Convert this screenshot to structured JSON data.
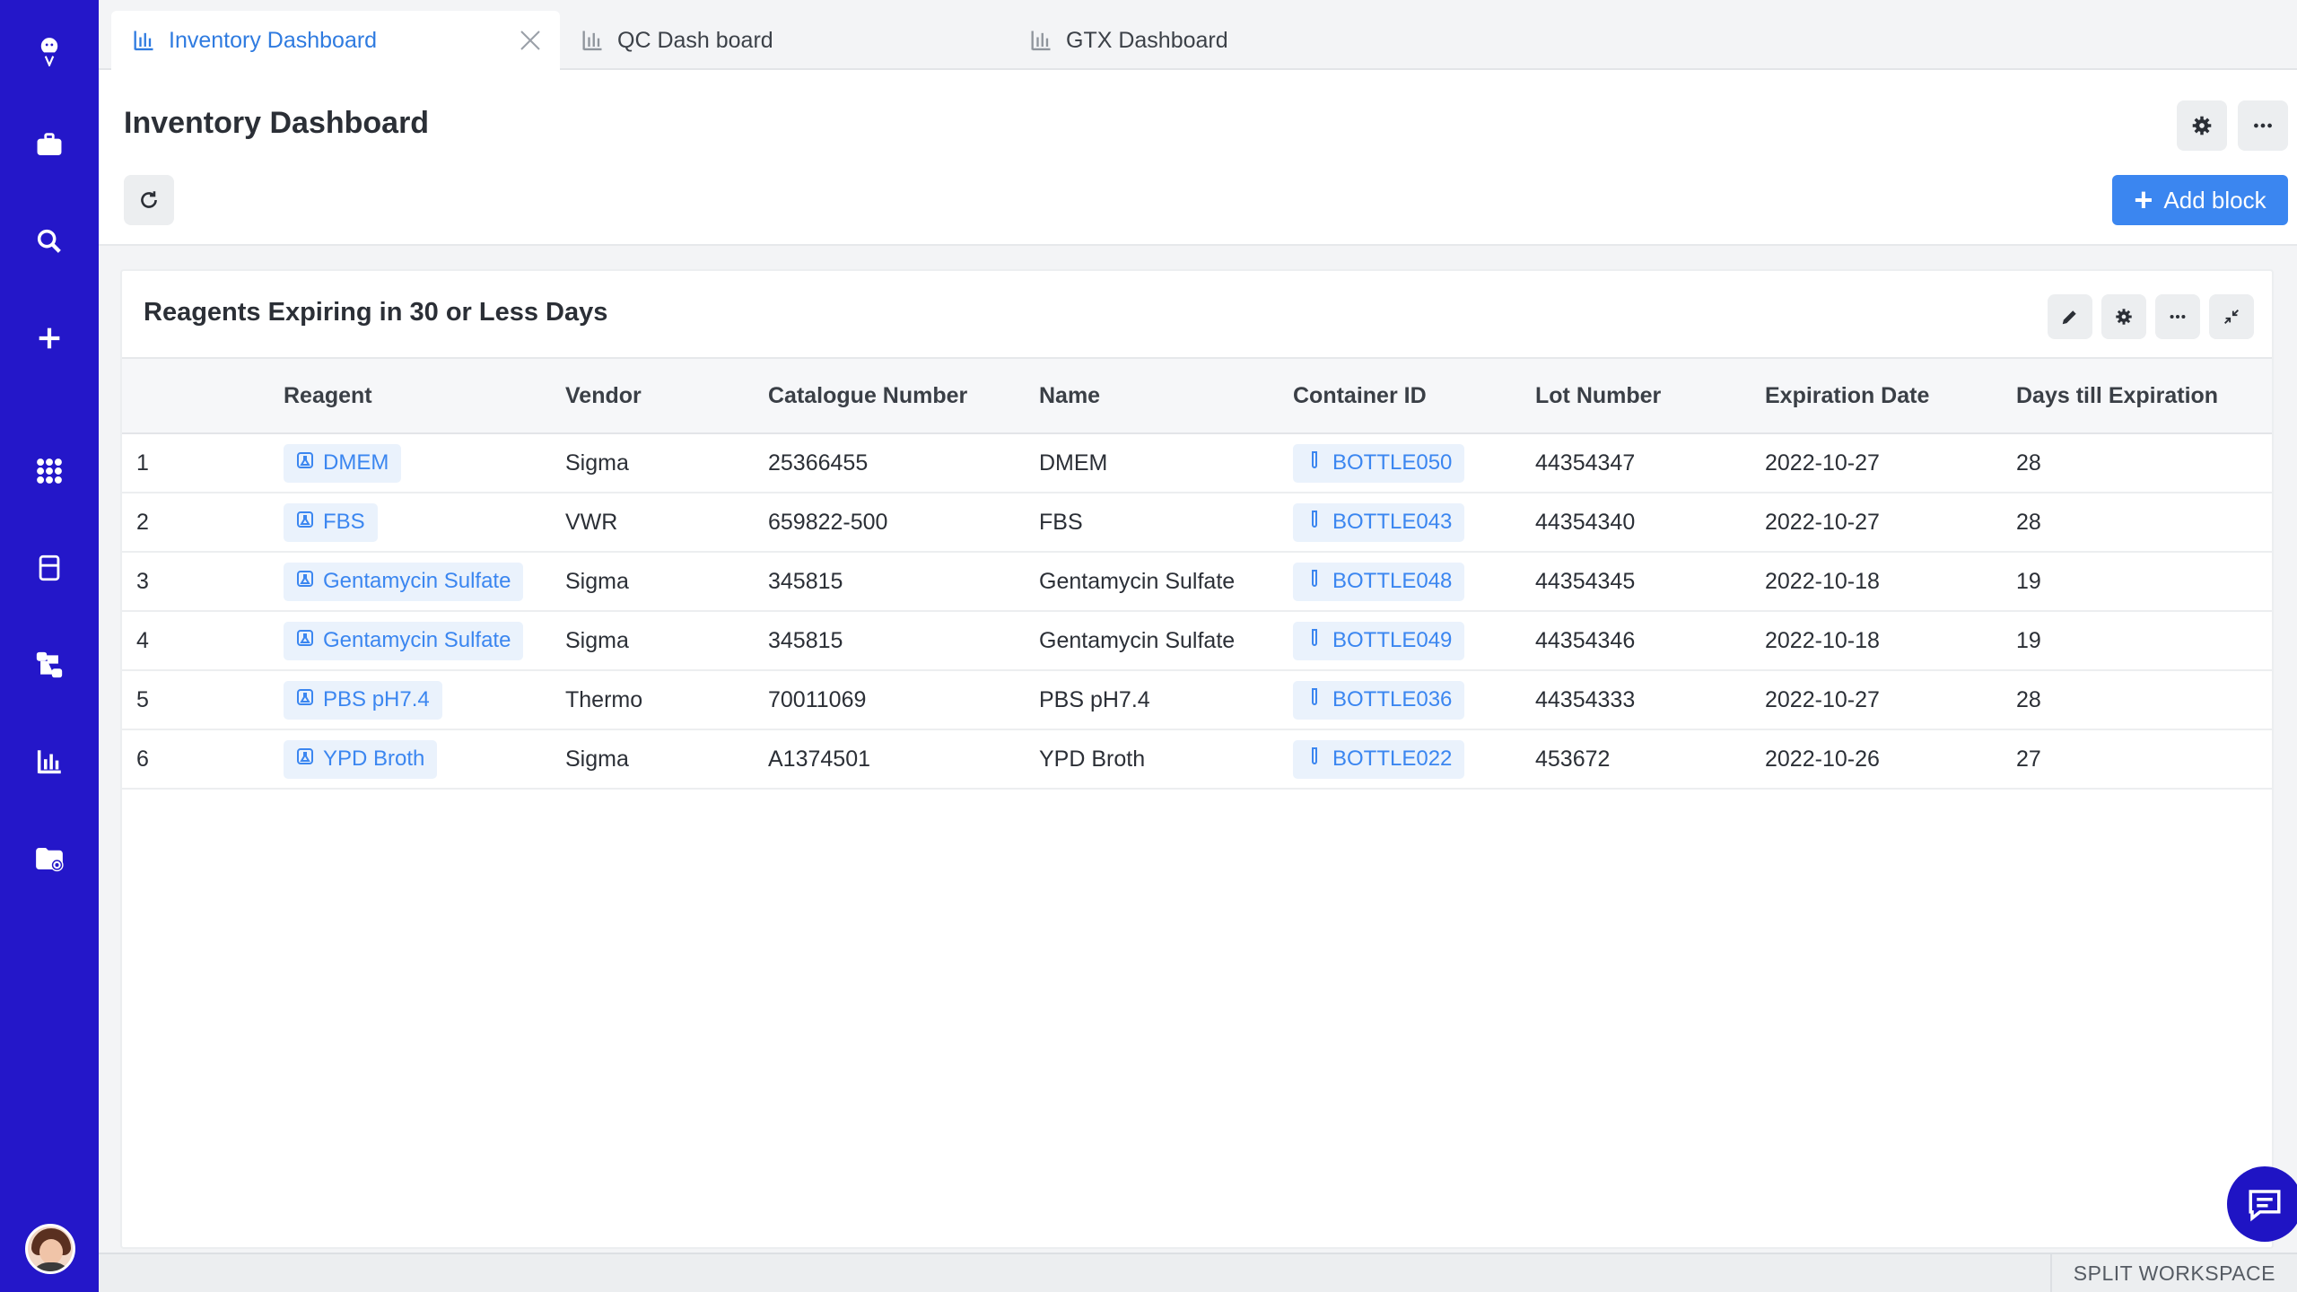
{
  "tabs": [
    {
      "label": "Inventory Dashboard",
      "active": true
    },
    {
      "label": "QC Dash board",
      "active": false
    },
    {
      "label": "GTX Dashboard",
      "active": false
    }
  ],
  "header": {
    "title": "Inventory Dashboard",
    "add_block_label": "Add block"
  },
  "card": {
    "title": "Reagents Expiring in 30 or Less Days",
    "columns": [
      "",
      "Reagent",
      "Vendor",
      "Catalogue Number",
      "Name",
      "Container ID",
      "Lot Number",
      "Expiration Date",
      "Days till Expiration"
    ],
    "rows": [
      {
        "index": "1",
        "reagent": "DMEM",
        "vendor": "Sigma",
        "catalogue": "25366455",
        "name": "DMEM",
        "container": "BOTTLE050",
        "lot": "44354347",
        "expiration": "2022-10-27",
        "days": "28"
      },
      {
        "index": "2",
        "reagent": "FBS",
        "vendor": "VWR",
        "catalogue": "659822-500",
        "name": "FBS",
        "container": "BOTTLE043",
        "lot": "44354340",
        "expiration": "2022-10-27",
        "days": "28"
      },
      {
        "index": "3",
        "reagent": "Gentamycin Sulfate",
        "vendor": "Sigma",
        "catalogue": "345815",
        "name": "Gentamycin Sulfate",
        "container": "BOTTLE048",
        "lot": "44354345",
        "expiration": "2022-10-18",
        "days": "19"
      },
      {
        "index": "4",
        "reagent": "Gentamycin Sulfate",
        "vendor": "Sigma",
        "catalogue": "345815",
        "name": "Gentamycin Sulfate",
        "container": "BOTTLE049",
        "lot": "44354346",
        "expiration": "2022-10-18",
        "days": "19"
      },
      {
        "index": "5",
        "reagent": "PBS pH7.4",
        "vendor": "Thermo",
        "catalogue": "70011069",
        "name": "PBS pH7.4",
        "container": "BOTTLE036",
        "lot": "44354333",
        "expiration": "2022-10-27",
        "days": "28"
      },
      {
        "index": "6",
        "reagent": "YPD Broth",
        "vendor": "Sigma",
        "catalogue": "A1374501",
        "name": "YPD Broth",
        "container": "BOTTLE022",
        "lot": "453672",
        "expiration": "2022-10-26",
        "days": "27"
      }
    ]
  },
  "footer": {
    "split_workspace_label": "SPLIT WORKSPACE"
  },
  "icons": {
    "rail": [
      "logo-icon",
      "briefcase-icon",
      "search-icon",
      "plus-icon",
      "apps-grid-icon",
      "registry-icon",
      "workflow-icon",
      "bar-chart-icon",
      "folder-settings-icon"
    ],
    "reagent_chip": "reagent-flask-icon",
    "container_chip": "tube-icon"
  },
  "colors": {
    "rail": "#2417c9",
    "accent": "#3b86f0",
    "chip_bg": "#eaf2fc",
    "chat_bubble": "#1f14c4"
  }
}
